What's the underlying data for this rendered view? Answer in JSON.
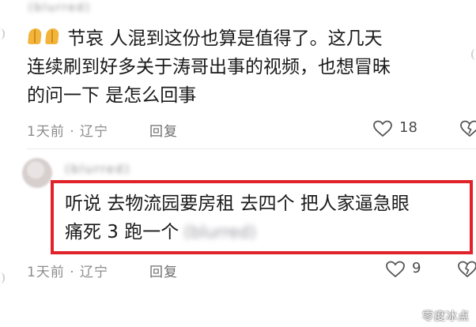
{
  "comment1": {
    "username": "(blurred)",
    "emojis": [
      "folded-hands",
      "folded-hands"
    ],
    "lines": [
      "节哀 人混到这份也算是值得了。这几天",
      "连续刷到好多关于涛哥出事的视频，也想冒昧",
      "的问一下 是怎么回事"
    ],
    "time_location": "1天前 · 辽宁",
    "reply_label": "回复",
    "like_count": "18"
  },
  "comment2": {
    "username": "(blurred)",
    "line1": "听说 去物流园要房租 去四个 把人家逼急眼",
    "line2": "痛死 3 跑一个",
    "line2_blurred": "(blurred)",
    "time_location": "1天前 · 辽宁",
    "reply_label": "回复",
    "like_count": "9"
  },
  "watermark": "零度冰点",
  "colors": {
    "highlight_border": "#e0222b",
    "meta_text": "#8c8c8c"
  }
}
